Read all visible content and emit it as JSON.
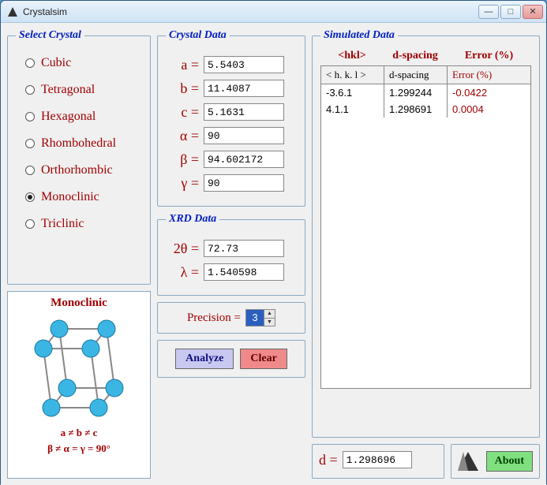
{
  "window": {
    "title": "Crystalsim"
  },
  "select_crystal": {
    "legend": "Select Crystal",
    "options": [
      "Cubic",
      "Tetragonal",
      "Hexagonal",
      "Rhombohedral",
      "Orthorhombic",
      "Monoclinic",
      "Triclinic"
    ],
    "selected_index": 5
  },
  "illustration": {
    "name": "Monoclinic",
    "formula_line1": "a ≠ b ≠ c",
    "formula_line2": "β ≠ α = γ = 90°"
  },
  "crystal_data": {
    "legend": "Crystal Data",
    "params": [
      {
        "label": "a =",
        "value": "5.5403"
      },
      {
        "label": "b =",
        "value": "11.4087"
      },
      {
        "label": "c =",
        "value": "5.1631"
      },
      {
        "label": "α =",
        "value": "90"
      },
      {
        "label": "β =",
        "value": "94.602172"
      },
      {
        "label": "γ =",
        "value": "90"
      }
    ]
  },
  "xrd_data": {
    "legend": "XRD Data",
    "params": [
      {
        "label": "2θ =",
        "value": "72.73"
      },
      {
        "label": "λ =",
        "value": "1.540598"
      }
    ]
  },
  "precision": {
    "label": "Precision =",
    "value": "3"
  },
  "buttons": {
    "analyze": "Analyze",
    "clear": "Clear",
    "about": "About"
  },
  "simulated": {
    "legend": "Simulated Data",
    "head": {
      "c1": "<hkl>",
      "c2": "d-spacing",
      "c3": "Error (%)"
    },
    "columns": {
      "c1": "< h. k. l >",
      "c2": "d-spacing",
      "c3": "Error (%)"
    },
    "rows": [
      {
        "hkl": "-3.6.1",
        "d": "1.299244",
        "err": "-0.0422"
      },
      {
        "hkl": "4.1.1",
        "d": "1.298691",
        "err": "0.0004"
      }
    ]
  },
  "d_result": {
    "label": "d =",
    "value": "1.298696"
  }
}
